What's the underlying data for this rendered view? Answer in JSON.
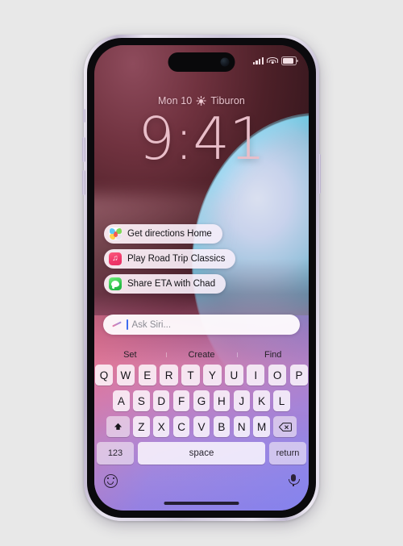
{
  "canvas": {
    "background_color": "#e8e8e8"
  },
  "device": {
    "name": "iPhone",
    "frame_color": "#cfc8dc",
    "dynamic_island": "dynamic-island",
    "home_indicator": "home-indicator"
  },
  "status_bar": {
    "cellular_icon": "cellular-signal-icon",
    "cellular_bars": 4,
    "wifi_icon": "wifi-icon",
    "battery_icon": "battery-icon",
    "battery_level": "full"
  },
  "lock_screen": {
    "date": "Mon 10",
    "weather_icon": "sun-icon",
    "location": "Tiburon",
    "time": "9:41",
    "time_color": "#e9bec9"
  },
  "siri": {
    "suggestions": [
      {
        "label": "Get directions Home",
        "icon": "maps-app-icon",
        "app": "Maps"
      },
      {
        "label": "Play Road Trip Classics",
        "icon": "music-app-icon",
        "app": "Music"
      },
      {
        "label": "Share ETA with Chad",
        "icon": "messages-app-icon",
        "app": "Messages"
      }
    ],
    "input": {
      "icon": "siri-orb-icon",
      "placeholder": "Ask Siri...",
      "value": "",
      "caret_visible": true,
      "caret_color": "#3d6df0"
    }
  },
  "keyboard": {
    "predictive": [
      "Set",
      "Create",
      "Find"
    ],
    "row1": [
      "Q",
      "W",
      "E",
      "R",
      "T",
      "Y",
      "U",
      "I",
      "O",
      "P"
    ],
    "row2": [
      "A",
      "S",
      "D",
      "F",
      "G",
      "H",
      "J",
      "K",
      "L"
    ],
    "row3": [
      "Z",
      "X",
      "C",
      "V",
      "B",
      "N",
      "M"
    ],
    "shift_key": "shift-key",
    "backspace_key": "backspace-key",
    "numbers_key": "123",
    "space_key": "space",
    "return_key": "return",
    "emoji_key": "emoji-key",
    "dictation_key": "dictation-microphone-key"
  }
}
